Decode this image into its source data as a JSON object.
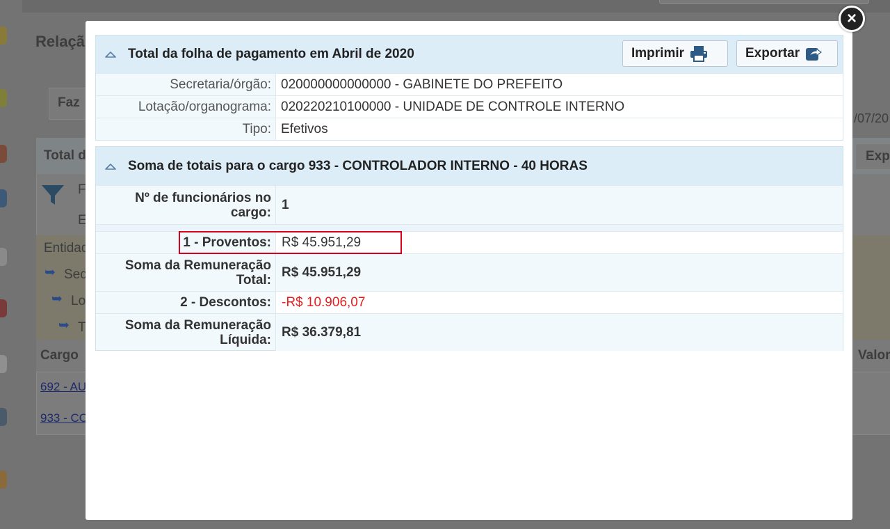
{
  "background": {
    "page_title": "Relaçã",
    "filter_button": "Faz",
    "panel_title": "Total d",
    "export_label": "Exp",
    "date_fragment": "/07/20",
    "filter_f": "F",
    "filter_e": "E",
    "entity": "Entidad",
    "tree": [
      "Sec",
      "Lo",
      "T"
    ],
    "column_cargo": "Cargo",
    "column_valor": "Valor",
    "rows": [
      "692 - AU",
      "933 - CO"
    ]
  },
  "modal": {
    "close_label": "×",
    "section1": {
      "title": "Total da folha de pagamento em Abril de 2020",
      "print_label": "Imprimir",
      "export_label": "Exportar",
      "rows": [
        {
          "label": "Secretaria/órgão:",
          "value": "020000000000000 - GABINETE DO PREFEITO"
        },
        {
          "label": "Lotação/organograma:",
          "value": "020220210100000 - UNIDADE DE CONTROLE INTERNO"
        },
        {
          "label": "Tipo:",
          "value": "Efetivos"
        }
      ]
    },
    "section2": {
      "title": "Soma de totais para o cargo 933 - CONTROLADOR INTERNO - 40 HORAS",
      "employees_label": "Nº de funcionários no cargo:",
      "employees_value": "1",
      "proventos_label": "1 - Proventos:",
      "proventos_value": "R$ 45.951,29",
      "rem_total_label": "Soma da Remuneração Total:",
      "rem_total_value": "R$ 45.951,29",
      "descontos_label": "2 - Descontos:",
      "descontos_value": "-R$ 10.906,07",
      "rem_liquida_label": "Soma da Remuneração Líquida:",
      "rem_liquida_value": "R$ 36.379,81"
    }
  },
  "colors": {
    "negative": "#e62020",
    "header_bg": "#dcedf8",
    "highlight_border": "#d9001b"
  }
}
